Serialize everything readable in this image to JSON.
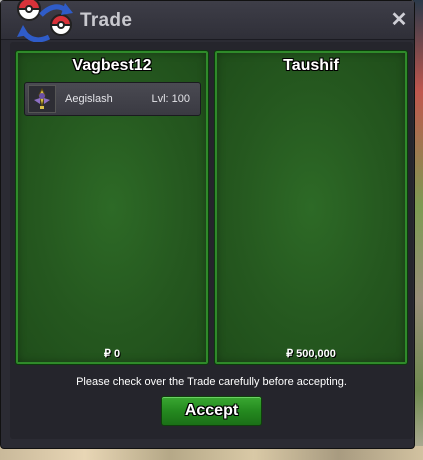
{
  "window": {
    "title": "Trade",
    "close_label": "✕"
  },
  "left_panel": {
    "player_name": "Vagbest12",
    "offer": [
      {
        "name": "Aegislash",
        "level": "Lvl: 100"
      }
    ],
    "money": "₽ 0"
  },
  "right_panel": {
    "player_name": "Taushif",
    "offer": [],
    "money": "₽ 500,000"
  },
  "notice": "Please check over the Trade carefully before accepting.",
  "accept_label": "Accept",
  "colors": {
    "panel_green": "#25581f",
    "accept_green": "#24891f",
    "window_bg": "#2b2b33"
  },
  "icons": {
    "logo": "pokeball-trade-logo-icon",
    "pokemon": "aegislash-sprite-icon",
    "close": "close-icon"
  }
}
